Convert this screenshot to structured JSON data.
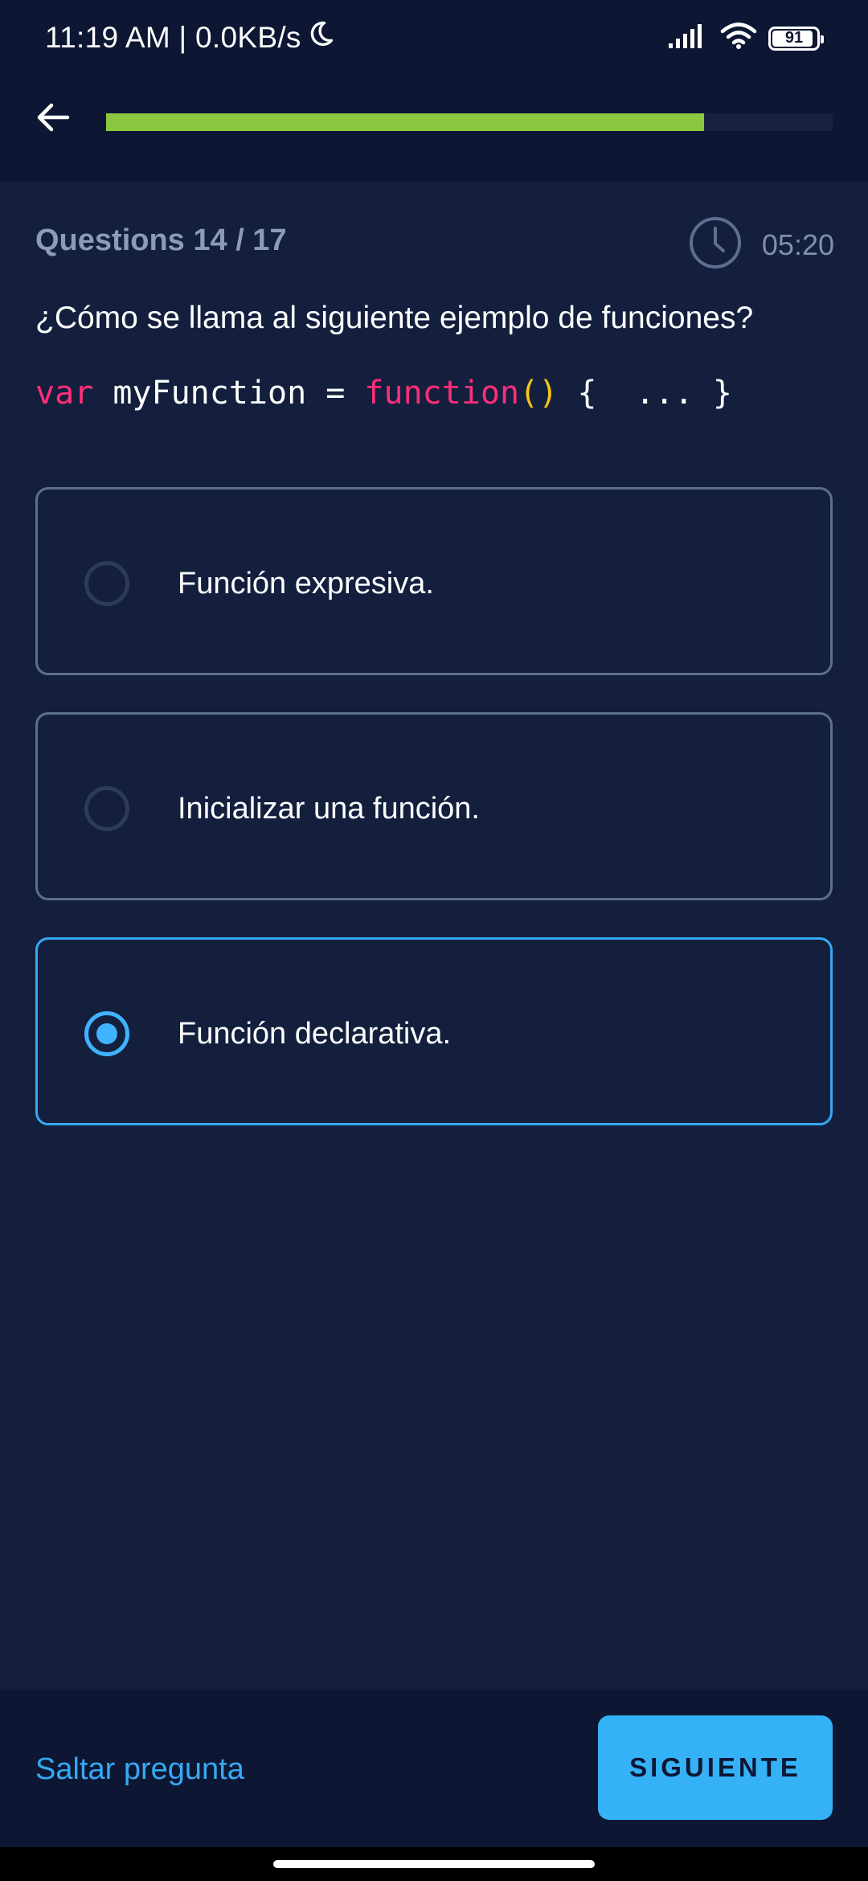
{
  "status_bar": {
    "time": "11:19 AM | 0.0KB/s",
    "battery": "91"
  },
  "header": {
    "progress_fraction": 0.8235
  },
  "quiz": {
    "counter": "Questions 14 / 17",
    "timer": "05:20",
    "question": "¿Cómo se llama al siguiente ejemplo de funciones?",
    "code": {
      "kw_var": "var",
      "ident": " myFunction = ",
      "kw_function": "function",
      "parens": "()",
      "rest": " {  ... }"
    },
    "options": [
      {
        "label": "Función expresiva.",
        "selected": false
      },
      {
        "label": "Inicializar una función.",
        "selected": false
      },
      {
        "label": "Función declarativa.",
        "selected": true
      }
    ]
  },
  "footer": {
    "skip_label": "Saltar pregunta",
    "next_label": "SIGUIENTE"
  },
  "colors": {
    "background": "#131f3d",
    "header_bg": "#0d1733",
    "progress": "#8dc63f",
    "accent": "#35b2f5",
    "keyword_pink": "#ff2e7a",
    "keyword_yellow": "#f5c518"
  },
  "icons": [
    "moon-icon",
    "signal-icon",
    "wifi-icon",
    "battery-icon",
    "back-arrow-icon",
    "clock-icon",
    "radio-icon"
  ]
}
